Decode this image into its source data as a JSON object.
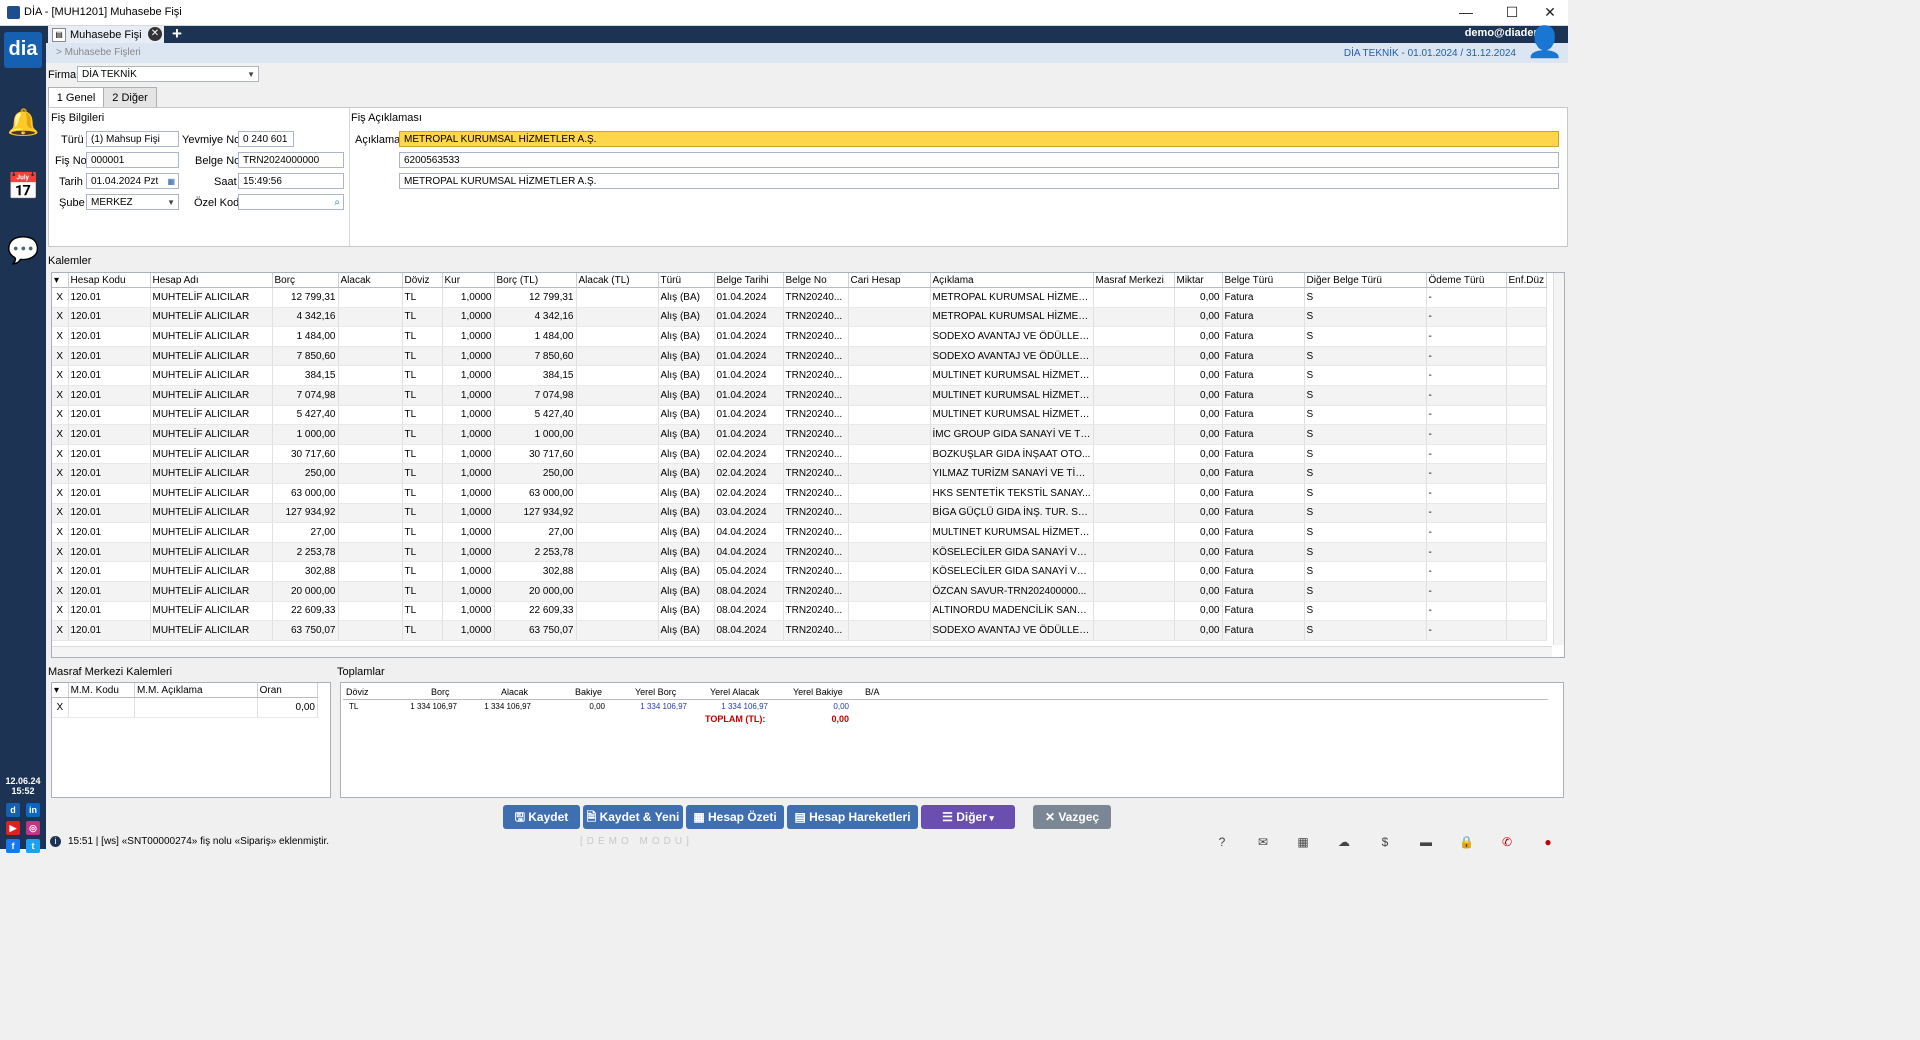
{
  "window": {
    "title": "DİA - [MUH1201] Muhasebe Fişi",
    "minimize": "—",
    "maximize": "☐",
    "close": "✕"
  },
  "sidebar": {
    "logo": "dia",
    "date": "12.06.24",
    "time": "15:52"
  },
  "tabs": {
    "active_tab": "Muhasebe Fişi",
    "user": "demo@diademo"
  },
  "subheader": {
    "breadcrumb": "> Muhasebe Fişleri",
    "period": "DİA TEKNİK -  01.01.2024 / 31.12.2024"
  },
  "firma": {
    "label": "Firma",
    "value": "DİA TEKNİK"
  },
  "pagetabs": [
    "1 Genel",
    "2 Diğer"
  ],
  "fis_bilgileri": {
    "title": "Fiş Bilgileri",
    "turu_label": "Türü",
    "turu_value": "(1) Mahsup Fişi",
    "yevmiye_label": "Yevmiye No",
    "yevmiye_value": "0 240 601",
    "fisno_label": "Fiş No",
    "fisno_value": "000001",
    "belgeno_label": "Belge No",
    "belgeno_value": "TRN2024000000",
    "tarih_label": "Tarih",
    "tarih_value": "01.04.2024 Pzt",
    "saat_label": "Saat",
    "saat_value": "15:49:56",
    "sube_label": "Şube",
    "sube_value": "MERKEZ",
    "ozelkod_label": "Özel Kod",
    "ozelkod_value": ""
  },
  "fis_aciklamasi": {
    "title": "Fiş Açıklaması",
    "label": "Açıklama",
    "line1": "METROPAL KURUMSAL HİZMETLER A.Ş.",
    "line2": "6200563533",
    "line3": "METROPAL KURUMSAL HİZMETLER A.Ş."
  },
  "kalemler": {
    "title": "Kalemler",
    "columns": [
      "Hesap Kodu",
      "Hesap Adı",
      "Borç",
      "Alacak",
      "Döviz",
      "Kur",
      "Borç (TL)",
      "Alacak (TL)",
      "Türü",
      "Belge Tarihi",
      "Belge No",
      "Cari Hesap",
      "Açıklama",
      "Masraf Merkezi",
      "Miktar",
      "Belge Türü",
      "Diğer Belge Türü",
      "Ödeme Türü",
      "Enf.Düz"
    ],
    "rows": [
      [
        "120.01",
        "MUHTELİF ALICILAR",
        "12 799,31",
        "",
        "TL",
        "1,0000",
        "12 799,31",
        "",
        "Alış (BA)",
        "01.04.2024",
        "TRN20240...",
        "",
        "METROPAL KURUMSAL HİZMET...",
        "",
        "0,00",
        "Fatura",
        "S",
        "-",
        ""
      ],
      [
        "120.01",
        "MUHTELİF ALICILAR",
        "4 342,16",
        "",
        "TL",
        "1,0000",
        "4 342,16",
        "",
        "Alış (BA)",
        "01.04.2024",
        "TRN20240...",
        "",
        "METROPAL KURUMSAL HİZMET...",
        "",
        "0,00",
        "Fatura",
        "S",
        "-",
        ""
      ],
      [
        "120.01",
        "MUHTELİF ALICILAR",
        "1 484,00",
        "",
        "TL",
        "1,0000",
        "1 484,00",
        "",
        "Alış (BA)",
        "01.04.2024",
        "TRN20240...",
        "",
        "SODEXO AVANTAJ VE ÖDÜLLEN...",
        "",
        "0,00",
        "Fatura",
        "S",
        "-",
        ""
      ],
      [
        "120.01",
        "MUHTELİF ALICILAR",
        "7 850,60",
        "",
        "TL",
        "1,0000",
        "7 850,60",
        "",
        "Alış (BA)",
        "01.04.2024",
        "TRN20240...",
        "",
        "SODEXO AVANTAJ VE ÖDÜLLEN...",
        "",
        "0,00",
        "Fatura",
        "S",
        "-",
        ""
      ],
      [
        "120.01",
        "MUHTELİF ALICILAR",
        "384,15",
        "",
        "TL",
        "1,0000",
        "384,15",
        "",
        "Alış (BA)",
        "01.04.2024",
        "TRN20240...",
        "",
        "MULTINET KURUMSAL HİZMETL...",
        "",
        "0,00",
        "Fatura",
        "S",
        "-",
        ""
      ],
      [
        "120.01",
        "MUHTELİF ALICILAR",
        "7 074,98",
        "",
        "TL",
        "1,0000",
        "7 074,98",
        "",
        "Alış (BA)",
        "01.04.2024",
        "TRN20240...",
        "",
        "MULTINET KURUMSAL HİZMETL...",
        "",
        "0,00",
        "Fatura",
        "S",
        "-",
        ""
      ],
      [
        "120.01",
        "MUHTELİF ALICILAR",
        "5 427,40",
        "",
        "TL",
        "1,0000",
        "5 427,40",
        "",
        "Alış (BA)",
        "01.04.2024",
        "TRN20240...",
        "",
        "MULTINET KURUMSAL HİZMETL...",
        "",
        "0,00",
        "Fatura",
        "S",
        "-",
        ""
      ],
      [
        "120.01",
        "MUHTELİF ALICILAR",
        "1 000,00",
        "",
        "TL",
        "1,0000",
        "1 000,00",
        "",
        "Alış (BA)",
        "01.04.2024",
        "TRN20240...",
        "",
        "İMC GROUP GIDA SANAYİ VE Tİ...",
        "",
        "0,00",
        "Fatura",
        "S",
        "-",
        ""
      ],
      [
        "120.01",
        "MUHTELİF ALICILAR",
        "30 717,60",
        "",
        "TL",
        "1,0000",
        "30 717,60",
        "",
        "Alış (BA)",
        "02.04.2024",
        "TRN20240...",
        "",
        "BOZKUŞLAR GIDA İNŞAAT OTO...",
        "",
        "0,00",
        "Fatura",
        "S",
        "-",
        ""
      ],
      [
        "120.01",
        "MUHTELİF ALICILAR",
        "250,00",
        "",
        "TL",
        "1,0000",
        "250,00",
        "",
        "Alış (BA)",
        "02.04.2024",
        "TRN20240...",
        "",
        "YILMAZ TURİZM SANAYİ VE TİC...",
        "",
        "0,00",
        "Fatura",
        "S",
        "-",
        ""
      ],
      [
        "120.01",
        "MUHTELİF ALICILAR",
        "63 000,00",
        "",
        "TL",
        "1,0000",
        "63 000,00",
        "",
        "Alış (BA)",
        "02.04.2024",
        "TRN20240...",
        "",
        "HKS SENTETİK TEKSTİL SANAY...",
        "",
        "0,00",
        "Fatura",
        "S",
        "-",
        ""
      ],
      [
        "120.01",
        "MUHTELİF ALICILAR",
        "127 934,92",
        "",
        "TL",
        "1,0000",
        "127 934,92",
        "",
        "Alış (BA)",
        "03.04.2024",
        "TRN20240...",
        "",
        "BİGA GÜÇLÜ GIDA İNŞ. TUR. SA...",
        "",
        "0,00",
        "Fatura",
        "S",
        "-",
        ""
      ],
      [
        "120.01",
        "MUHTELİF ALICILAR",
        "27,00",
        "",
        "TL",
        "1,0000",
        "27,00",
        "",
        "Alış (BA)",
        "04.04.2024",
        "TRN20240...",
        "",
        "MULTINET KURUMSAL HİZMETL...",
        "",
        "0,00",
        "Fatura",
        "S",
        "-",
        ""
      ],
      [
        "120.01",
        "MUHTELİF ALICILAR",
        "2 253,78",
        "",
        "TL",
        "1,0000",
        "2 253,78",
        "",
        "Alış (BA)",
        "04.04.2024",
        "TRN20240...",
        "",
        "KÖSELECİLER GIDA SANAYİ VE ...",
        "",
        "0,00",
        "Fatura",
        "S",
        "-",
        ""
      ],
      [
        "120.01",
        "MUHTELİF ALICILAR",
        "302,88",
        "",
        "TL",
        "1,0000",
        "302,88",
        "",
        "Alış (BA)",
        "05.04.2024",
        "TRN20240...",
        "",
        "KÖSELECİLER GIDA SANAYİ VE ...",
        "",
        "0,00",
        "Fatura",
        "S",
        "-",
        ""
      ],
      [
        "120.01",
        "MUHTELİF ALICILAR",
        "20 000,00",
        "",
        "TL",
        "1,0000",
        "20 000,00",
        "",
        "Alış (BA)",
        "08.04.2024",
        "TRN20240...",
        "",
        "ÖZCAN SAVUR-TRN202400000...",
        "",
        "0,00",
        "Fatura",
        "S",
        "-",
        ""
      ],
      [
        "120.01",
        "MUHTELİF ALICILAR",
        "22 609,33",
        "",
        "TL",
        "1,0000",
        "22 609,33",
        "",
        "Alış (BA)",
        "08.04.2024",
        "TRN20240...",
        "",
        "ALTINORDU MADENCİLİK SANA...",
        "",
        "0,00",
        "Fatura",
        "S",
        "-",
        ""
      ],
      [
        "120.01",
        "MUHTELİF ALICILAR",
        "63 750,07",
        "",
        "TL",
        "1,0000",
        "63 750,07",
        "",
        "Alış (BA)",
        "08.04.2024",
        "TRN20240...",
        "",
        "SODEXO AVANTAJ VE ÖDÜLLEN...",
        "",
        "0,00",
        "Fatura",
        "S",
        "-",
        ""
      ]
    ]
  },
  "masraf": {
    "title": "Masraf Merkezi Kalemleri",
    "columns": [
      "M.M. Kodu",
      "M.M. Açıklama",
      "Oran"
    ],
    "row": [
      "",
      "",
      "0,00"
    ]
  },
  "toplamlar": {
    "title": "Toplamlar",
    "columns": [
      "Döviz",
      "Borç",
      "Alacak",
      "Bakiye",
      "Yerel Borç",
      "Yerel Alacak",
      "Yerel Bakiye",
      "B/A"
    ],
    "row": [
      "TL",
      "1 334 106,97",
      "1 334 106,97",
      "0,00",
      "1 334 106,97",
      "1 334 106,97",
      "0,00",
      ""
    ],
    "total_label": "TOPLAM (TL):",
    "total_value": "0,00"
  },
  "buttons": {
    "kaydet": "Kaydet",
    "kaydet_yeni": "Kaydet & Yeni",
    "hesap_ozeti": "Hesap Özeti",
    "hesap_hareketleri": "Hesap Hareketleri",
    "diger": "Diğer",
    "vazgec": "Vazgeç"
  },
  "status": {
    "message": "15:51  |  [ws] «SNT00000274» fiş nolu «Sipariş» eklenmiştir.",
    "watermark": "[DEMO MODU]"
  },
  "colors": {
    "sidebar": "#1c3354",
    "accent": "#3f6fb0",
    "highlight": "#ffd54a"
  }
}
